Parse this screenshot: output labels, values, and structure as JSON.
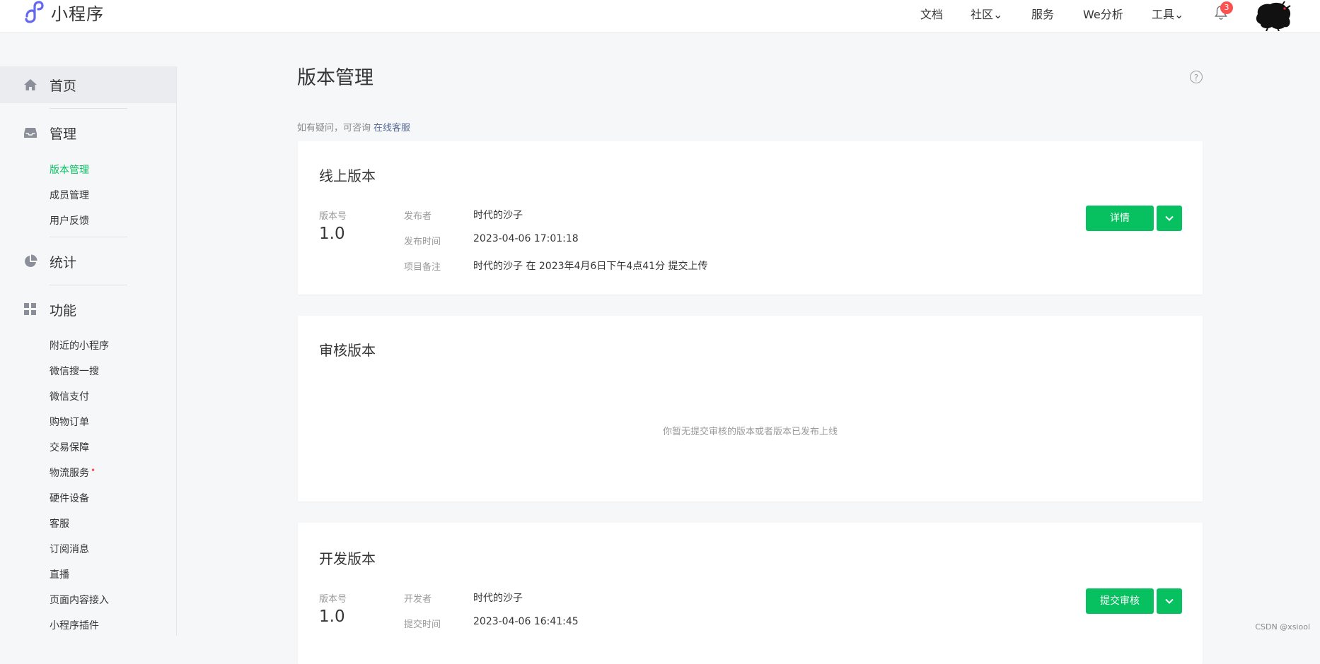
{
  "header": {
    "app_name": "小程序",
    "nav": [
      "文档",
      "社区",
      "服务",
      "We分析",
      "工具"
    ],
    "notification_count": "3"
  },
  "sidebar": {
    "sections": {
      "home": "首页",
      "manage": "管理",
      "stats": "统计",
      "features": "功能"
    },
    "manage_items": [
      "版本管理",
      "成员管理",
      "用户反馈"
    ],
    "feature_items": [
      "附近的小程序",
      "微信搜一搜",
      "微信支付",
      "购物订单",
      "交易保障",
      "物流服务",
      "硬件设备",
      "客服",
      "订阅消息",
      "直播",
      "页面内容接入",
      "小程序插件"
    ]
  },
  "main": {
    "title": "版本管理",
    "hint_text": "如有疑问，可咨询",
    "hint_link": "在线客服",
    "online": {
      "title": "线上版本",
      "version_label": "版本号",
      "version": "1.0",
      "publisher_label": "发布者",
      "publisher": "时代的沙子",
      "time_label": "发布时间",
      "time": "2023-04-06 17:01:18",
      "note_label": "项目备注",
      "note": "时代的沙子 在 2023年4月6日下午4点41分 提交上传",
      "detail_button": "详情"
    },
    "review": {
      "title": "审核版本",
      "empty": "你暂无提交审核的版本或者版本已发布上线"
    },
    "dev": {
      "title": "开发版本",
      "version_label": "版本号",
      "version": "1.0",
      "developer_label": "开发者",
      "developer": "时代的沙子",
      "time_label": "提交时间",
      "time": "2023-04-06 16:41:45",
      "submit_button": "提交审核"
    }
  },
  "watermark": "CSDN @xsiool",
  "colors": {
    "accent": "#07c160",
    "badge": "#fa5151",
    "link": "#576b95"
  }
}
